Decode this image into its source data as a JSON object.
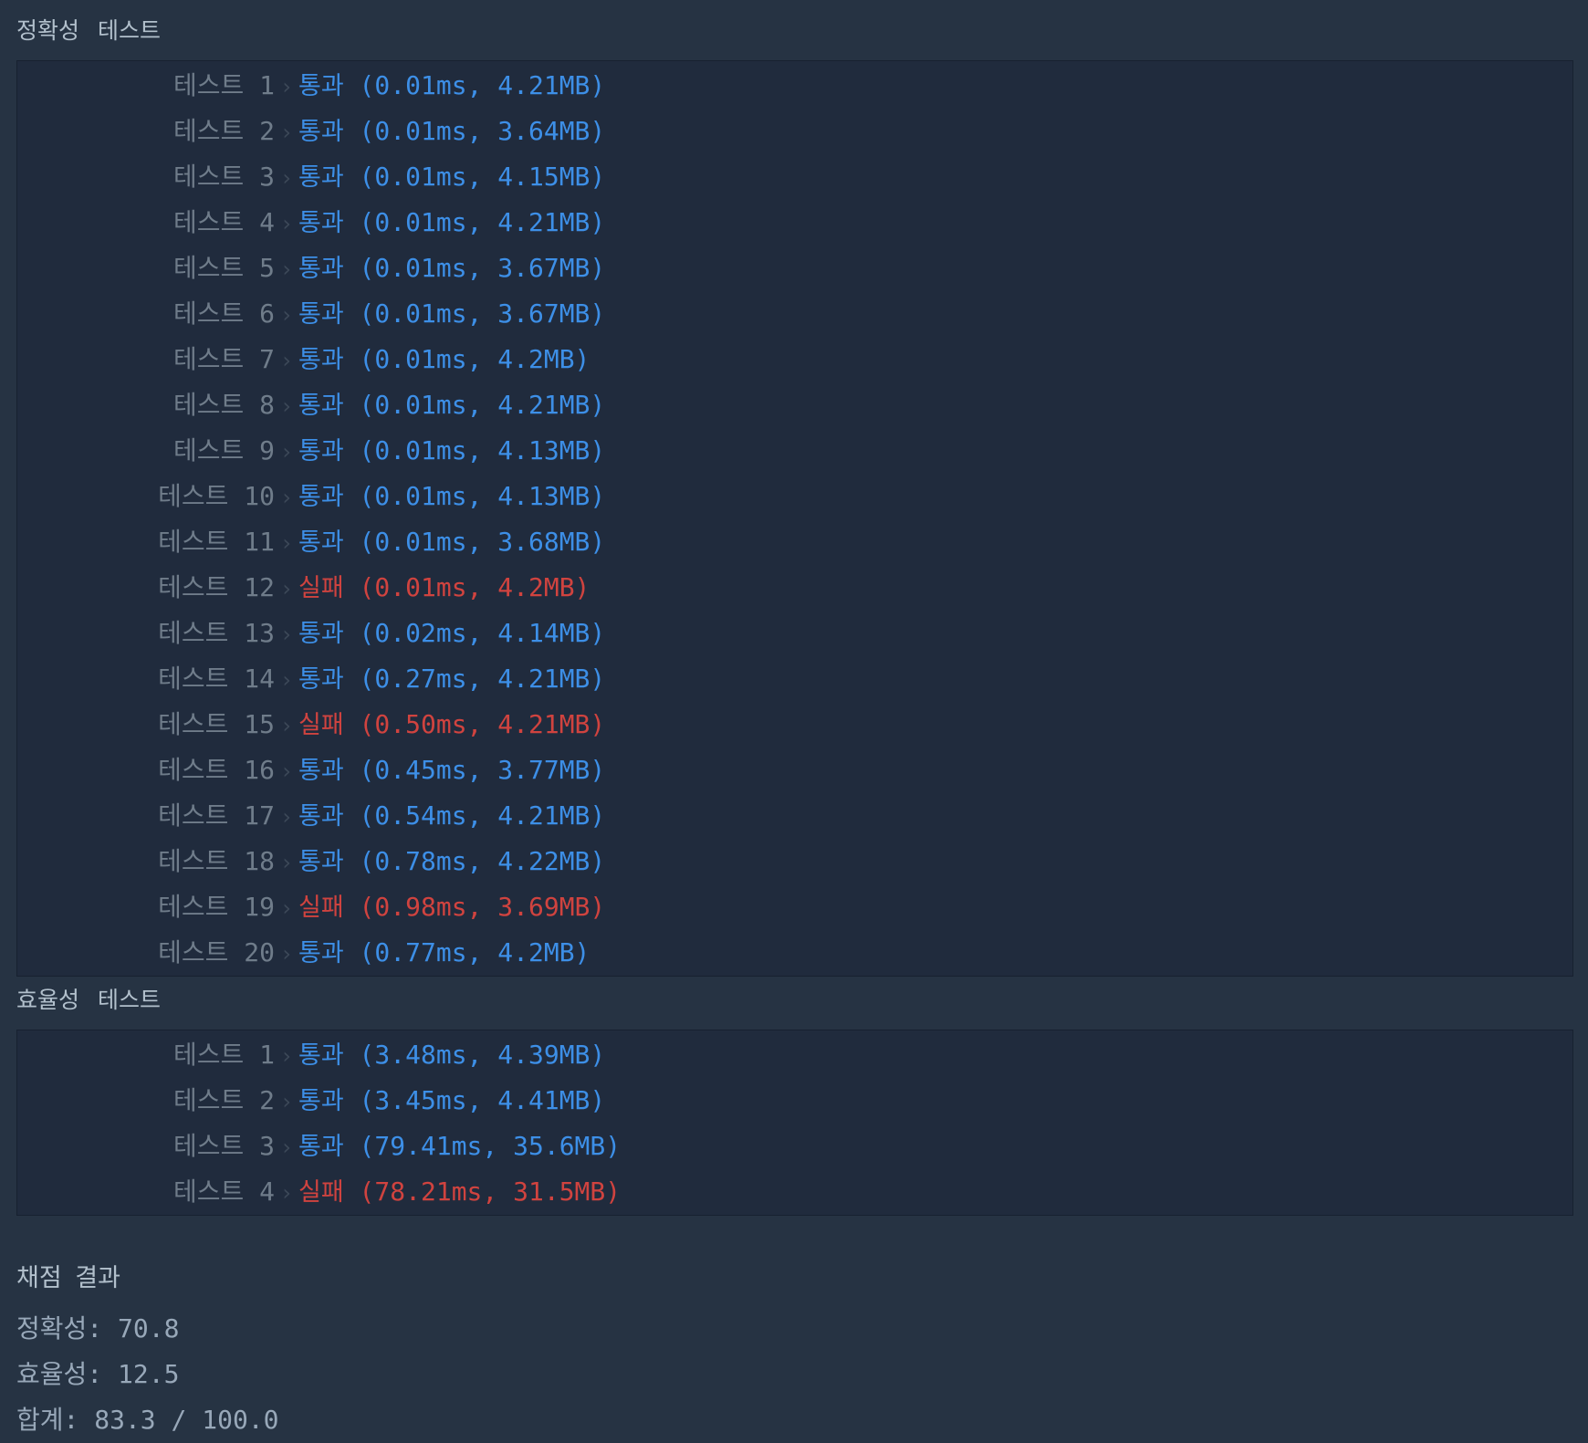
{
  "accuracy_section": {
    "title": "정확성  테스트",
    "tests": [
      {
        "label": "테스트",
        "num": "1",
        "status": "통과",
        "detail": "(0.01ms, 4.21MB)",
        "pass": true
      },
      {
        "label": "테스트",
        "num": "2",
        "status": "통과",
        "detail": "(0.01ms, 3.64MB)",
        "pass": true
      },
      {
        "label": "테스트",
        "num": "3",
        "status": "통과",
        "detail": "(0.01ms, 4.15MB)",
        "pass": true
      },
      {
        "label": "테스트",
        "num": "4",
        "status": "통과",
        "detail": "(0.01ms, 4.21MB)",
        "pass": true
      },
      {
        "label": "테스트",
        "num": "5",
        "status": "통과",
        "detail": "(0.01ms, 3.67MB)",
        "pass": true
      },
      {
        "label": "테스트",
        "num": "6",
        "status": "통과",
        "detail": "(0.01ms, 3.67MB)",
        "pass": true
      },
      {
        "label": "테스트",
        "num": "7",
        "status": "통과",
        "detail": "(0.01ms, 4.2MB)",
        "pass": true
      },
      {
        "label": "테스트",
        "num": "8",
        "status": "통과",
        "detail": "(0.01ms, 4.21MB)",
        "pass": true
      },
      {
        "label": "테스트",
        "num": "9",
        "status": "통과",
        "detail": "(0.01ms, 4.13MB)",
        "pass": true
      },
      {
        "label": "테스트",
        "num": "10",
        "status": "통과",
        "detail": "(0.01ms, 4.13MB)",
        "pass": true
      },
      {
        "label": "테스트",
        "num": "11",
        "status": "통과",
        "detail": "(0.01ms, 3.68MB)",
        "pass": true
      },
      {
        "label": "테스트",
        "num": "12",
        "status": "실패",
        "detail": "(0.01ms, 4.2MB)",
        "pass": false
      },
      {
        "label": "테스트",
        "num": "13",
        "status": "통과",
        "detail": "(0.02ms, 4.14MB)",
        "pass": true
      },
      {
        "label": "테스트",
        "num": "14",
        "status": "통과",
        "detail": "(0.27ms, 4.21MB)",
        "pass": true
      },
      {
        "label": "테스트",
        "num": "15",
        "status": "실패",
        "detail": "(0.50ms, 4.21MB)",
        "pass": false
      },
      {
        "label": "테스트",
        "num": "16",
        "status": "통과",
        "detail": "(0.45ms, 3.77MB)",
        "pass": true
      },
      {
        "label": "테스트",
        "num": "17",
        "status": "통과",
        "detail": "(0.54ms, 4.21MB)",
        "pass": true
      },
      {
        "label": "테스트",
        "num": "18",
        "status": "통과",
        "detail": "(0.78ms, 4.22MB)",
        "pass": true
      },
      {
        "label": "테스트",
        "num": "19",
        "status": "실패",
        "detail": "(0.98ms, 3.69MB)",
        "pass": false
      },
      {
        "label": "테스트",
        "num": "20",
        "status": "통과",
        "detail": "(0.77ms, 4.2MB)",
        "pass": true
      }
    ]
  },
  "efficiency_section": {
    "title": "효율성  테스트",
    "tests": [
      {
        "label": "테스트",
        "num": "1",
        "status": "통과",
        "detail": "(3.48ms, 4.39MB)",
        "pass": true
      },
      {
        "label": "테스트",
        "num": "2",
        "status": "통과",
        "detail": "(3.45ms, 4.41MB)",
        "pass": true
      },
      {
        "label": "테스트",
        "num": "3",
        "status": "통과",
        "detail": "(79.41ms, 35.6MB)",
        "pass": true
      },
      {
        "label": "테스트",
        "num": "4",
        "status": "실패",
        "detail": "(78.21ms, 31.5MB)",
        "pass": false
      }
    ]
  },
  "summary": {
    "title": "채점 결과",
    "accuracy": "정확성: 70.8",
    "efficiency": "효율성: 12.5",
    "total": "합계: 83.3 / 100.0"
  },
  "colors": {
    "background": "#263343",
    "panel": "#202b3d",
    "pass": "#3d8fe7",
    "fail": "#d0433f",
    "label": "#6f7c8a"
  },
  "icons": {
    "separator": "chevron-right-icon"
  }
}
